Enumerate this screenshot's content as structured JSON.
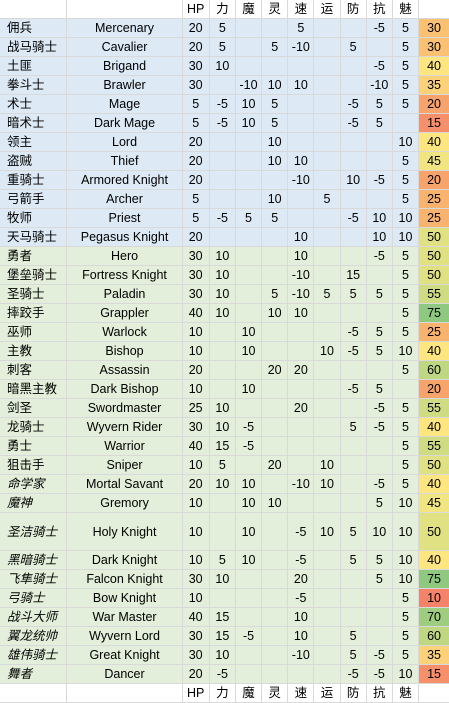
{
  "columns": [
    "HP",
    "力",
    "魔",
    "灵",
    "速",
    "运",
    "防",
    "抗",
    "魅"
  ],
  "rows": [
    {
      "cn": "佣兵",
      "en": "Mercenary",
      "v": [
        "20",
        "5",
        "",
        "",
        "5",
        "",
        "",
        "-5",
        "5"
      ],
      "total": "30",
      "color": "#f9c171",
      "group": "blue"
    },
    {
      "cn": "战马骑士",
      "en": "Cavalier",
      "v": [
        "20",
        "5",
        "",
        "5",
        "-10",
        "",
        "5",
        "",
        "5"
      ],
      "total": "30",
      "color": "#f9c171",
      "group": "blue"
    },
    {
      "cn": "土匪",
      "en": "Brigand",
      "v": [
        "30",
        "10",
        "",
        "",
        "",
        "",
        "",
        "-5",
        "5"
      ],
      "total": "40",
      "color": "#fde57f",
      "group": "blue"
    },
    {
      "cn": "拳斗士",
      "en": "Brawler",
      "v": [
        "30",
        "",
        "-10",
        "10",
        "10",
        "",
        "",
        "-10",
        "5"
      ],
      "total": "35",
      "color": "#fbd179",
      "group": "blue"
    },
    {
      "cn": "术士",
      "en": "Mage",
      "v": [
        "5",
        "-5",
        "10",
        "5",
        "",
        "",
        "-5",
        "5",
        "5"
      ],
      "total": "20",
      "color": "#f7a46c",
      "group": "blue"
    },
    {
      "cn": "暗术士",
      "en": "Dark Mage",
      "v": [
        "5",
        "-5",
        "10",
        "5",
        "",
        "",
        "-5",
        "5",
        ""
      ],
      "total": "15",
      "color": "#f6906b",
      "group": "blue"
    },
    {
      "cn": "领主",
      "en": "Lord",
      "v": [
        "20",
        "",
        "",
        "10",
        "",
        "",
        "",
        "",
        "10"
      ],
      "total": "40",
      "color": "#fde57f",
      "group": "blue"
    },
    {
      "cn": "盗贼",
      "en": "Thief",
      "v": [
        "20",
        "",
        "",
        "10",
        "10",
        "",
        "",
        "",
        "5"
      ],
      "total": "45",
      "color": "#f1e581",
      "group": "blue"
    },
    {
      "cn": "重骑士",
      "en": "Armored Knight",
      "v": [
        "20",
        "",
        "",
        "",
        "-10",
        "",
        "10",
        "-5",
        "5"
      ],
      "total": "20",
      "color": "#f7a46c",
      "group": "blue"
    },
    {
      "cn": "弓箭手",
      "en": "Archer",
      "v": [
        "5",
        "",
        "",
        "10",
        "",
        "5",
        "",
        "",
        "5"
      ],
      "total": "25",
      "color": "#f8b46f",
      "group": "blue"
    },
    {
      "cn": "牧师",
      "en": "Priest",
      "v": [
        "5",
        "-5",
        "5",
        "5",
        "",
        "",
        "-5",
        "10",
        "10"
      ],
      "total": "25",
      "color": "#f8b46f",
      "group": "blue"
    },
    {
      "cn": "天马骑士",
      "en": "Pegasus Knight",
      "v": [
        "20",
        "",
        "",
        "",
        "10",
        "",
        "",
        "10",
        "10"
      ],
      "total": "50",
      "color": "#e0e182",
      "group": "blue"
    },
    {
      "cn": "勇者",
      "en": "Hero",
      "v": [
        "30",
        "10",
        "",
        "",
        "10",
        "",
        "",
        "-5",
        "5"
      ],
      "total": "50",
      "color": "#e0e182",
      "group": "green"
    },
    {
      "cn": "堡垒骑士",
      "en": "Fortress Knight",
      "v": [
        "30",
        "10",
        "",
        "",
        "-10",
        "",
        "15",
        "",
        "5"
      ],
      "total": "50",
      "color": "#e0e182",
      "group": "green"
    },
    {
      "cn": "圣骑士",
      "en": "Paladin",
      "v": [
        "30",
        "10",
        "",
        "5",
        "-10",
        "5",
        "5",
        "5",
        "5"
      ],
      "total": "55",
      "color": "#cfdc82",
      "group": "green"
    },
    {
      "cn": "摔跤手",
      "en": "Grappler",
      "v": [
        "40",
        "10",
        "",
        "10",
        "10",
        "",
        "",
        "",
        "5"
      ],
      "total": "75",
      "color": "#8ec97f",
      "group": "green"
    },
    {
      "cn": "巫师",
      "en": "Warlock",
      "v": [
        "10",
        "",
        "10",
        "",
        "",
        "",
        "-5",
        "5",
        "5"
      ],
      "total": "25",
      "color": "#f8b46f",
      "group": "green"
    },
    {
      "cn": "主教",
      "en": "Bishop",
      "v": [
        "10",
        "",
        "10",
        "",
        "",
        "10",
        "-5",
        "5",
        "10"
      ],
      "total": "40",
      "color": "#fde57f",
      "group": "green"
    },
    {
      "cn": "刺客",
      "en": "Assassin",
      "v": [
        "20",
        "",
        "",
        "20",
        "20",
        "",
        "",
        "",
        "5"
      ],
      "total": "60",
      "color": "#bfd781",
      "group": "green"
    },
    {
      "cn": "暗黑主教",
      "en": "Dark Bishop",
      "v": [
        "10",
        "",
        "10",
        "",
        "",
        "",
        "-5",
        "5",
        ""
      ],
      "total": "20",
      "color": "#f7a46c",
      "group": "green"
    },
    {
      "cn": "剑圣",
      "en": "Swordmaster",
      "v": [
        "25",
        "10",
        "",
        "",
        "20",
        "",
        "",
        "-5",
        "5"
      ],
      "total": "55",
      "color": "#cfdc82",
      "group": "green"
    },
    {
      "cn": "龙骑士",
      "en": "Wyvern Rider",
      "v": [
        "30",
        "10",
        "-5",
        "",
        "",
        "",
        "5",
        "-5",
        "5"
      ],
      "total": "40",
      "color": "#fde57f",
      "group": "green"
    },
    {
      "cn": "勇士",
      "en": "Warrior",
      "v": [
        "40",
        "15",
        "-5",
        "",
        "",
        "",
        "",
        "",
        "5"
      ],
      "total": "55",
      "color": "#cfdc82",
      "group": "green"
    },
    {
      "cn": "狙击手",
      "en": "Sniper",
      "v": [
        "10",
        "5",
        "",
        "20",
        "",
        "10",
        "",
        "",
        "5"
      ],
      "total": "50",
      "color": "#e0e182",
      "group": "green"
    },
    {
      "cn": "命学家",
      "en": "Mortal Savant",
      "v": [
        "20",
        "10",
        "10",
        "",
        "-10",
        "10",
        "",
        "-5",
        "5"
      ],
      "total": "40",
      "color": "#fde57f",
      "group": "green",
      "italic": true
    },
    {
      "cn": "魔神",
      "en": "Gremory",
      "v": [
        "10",
        "",
        "10",
        "10",
        "",
        "",
        "",
        "5",
        "10"
      ],
      "total": "45",
      "color": "#f1e581",
      "group": "green",
      "italic": true
    },
    {
      "cn": "圣洁骑士",
      "en": "Holy Knight",
      "v": [
        "10",
        "",
        "10",
        "",
        "-5",
        "10",
        "5",
        "10",
        "10"
      ],
      "total": "50",
      "color": "#e0e182",
      "group": "green",
      "italic": true,
      "tall": true
    },
    {
      "cn": "黑暗骑士",
      "en": "Dark Knight",
      "v": [
        "10",
        "5",
        "10",
        "",
        "-5",
        "",
        "5",
        "5",
        "10"
      ],
      "total": "40",
      "color": "#fde57f",
      "group": "green",
      "italic": true
    },
    {
      "cn": "飞隼骑士",
      "en": "Falcon Knight",
      "v": [
        "30",
        "10",
        "",
        "",
        "20",
        "",
        "",
        "5",
        "10"
      ],
      "total": "75",
      "color": "#8ec97f",
      "group": "green",
      "italic": true
    },
    {
      "cn": "弓骑士",
      "en": "Bow Knight",
      "v": [
        "10",
        "",
        "",
        "",
        "-5",
        "",
        "",
        "",
        "5"
      ],
      "total": "10",
      "color": "#f4836a",
      "group": "green",
      "italic": true
    },
    {
      "cn": "战斗大师",
      "en": "War Master",
      "v": [
        "40",
        "15",
        "",
        "",
        "10",
        "",
        "",
        "",
        "5"
      ],
      "total": "70",
      "color": "#9ecd80",
      "group": "green",
      "italic": true
    },
    {
      "cn": "翼龙统帅",
      "en": "Wyvern Lord",
      "v": [
        "30",
        "15",
        "-5",
        "",
        "10",
        "",
        "5",
        "",
        "5"
      ],
      "total": "60",
      "color": "#bfd781",
      "group": "green",
      "italic": true
    },
    {
      "cn": "雄伟骑士",
      "en": "Great Knight",
      "v": [
        "30",
        "10",
        "",
        "",
        "-10",
        "",
        "5",
        "-5",
        "5"
      ],
      "total": "35",
      "color": "#fbd179",
      "group": "green",
      "italic": true
    },
    {
      "cn": "舞者",
      "en": "Dancer",
      "v": [
        "20",
        "-5",
        "",
        "",
        "",
        "",
        "-5",
        "-5",
        "10"
      ],
      "total": "15",
      "color": "#f6906b",
      "group": "green",
      "italic": true
    }
  ]
}
